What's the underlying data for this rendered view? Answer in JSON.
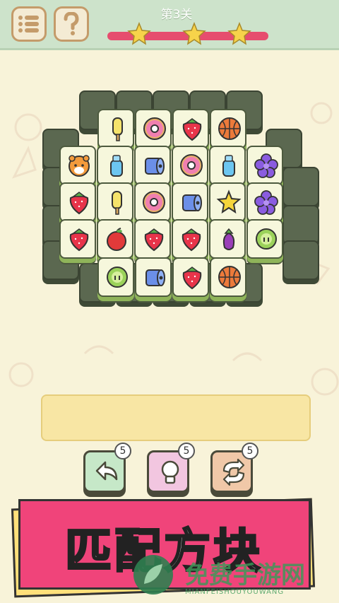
{
  "header": {
    "level_label": "第3关",
    "progress": 0.0,
    "stars": 3
  },
  "toolbar": {
    "menu_icon": "list-icon",
    "help_icon": "question-icon"
  },
  "board": {
    "top_tiles": [
      [
        "popsicle",
        "donut",
        "strawberry",
        "basketball"
      ],
      [
        "tiger",
        "bottle",
        "toilet-paper",
        "donut",
        "bottle",
        "flower"
      ],
      [
        "strawberry",
        "popsicle",
        "donut",
        "toilet-paper",
        "star",
        "flower"
      ],
      [
        "strawberry",
        "apple",
        "strawberry",
        "strawberry",
        "eggplant",
        "durian"
      ],
      [
        "durian",
        "toilet-paper",
        "strawberry",
        "basketball"
      ]
    ]
  },
  "powerups": [
    {
      "name": "undo",
      "icon": "undo-arrow-icon",
      "count": "5",
      "color": "#c6e8c8"
    },
    {
      "name": "hint",
      "icon": "lightbulb-icon",
      "count": "5",
      "color": "#f2c6e0"
    },
    {
      "name": "shuffle",
      "icon": "shuffle-icon",
      "count": "5",
      "color": "#f0c8a8"
    }
  ],
  "banner": {
    "title": "匹配方块"
  },
  "watermark": {
    "text": "免费手游网",
    "sub": "MIANFEISHOUYOUWANG"
  }
}
